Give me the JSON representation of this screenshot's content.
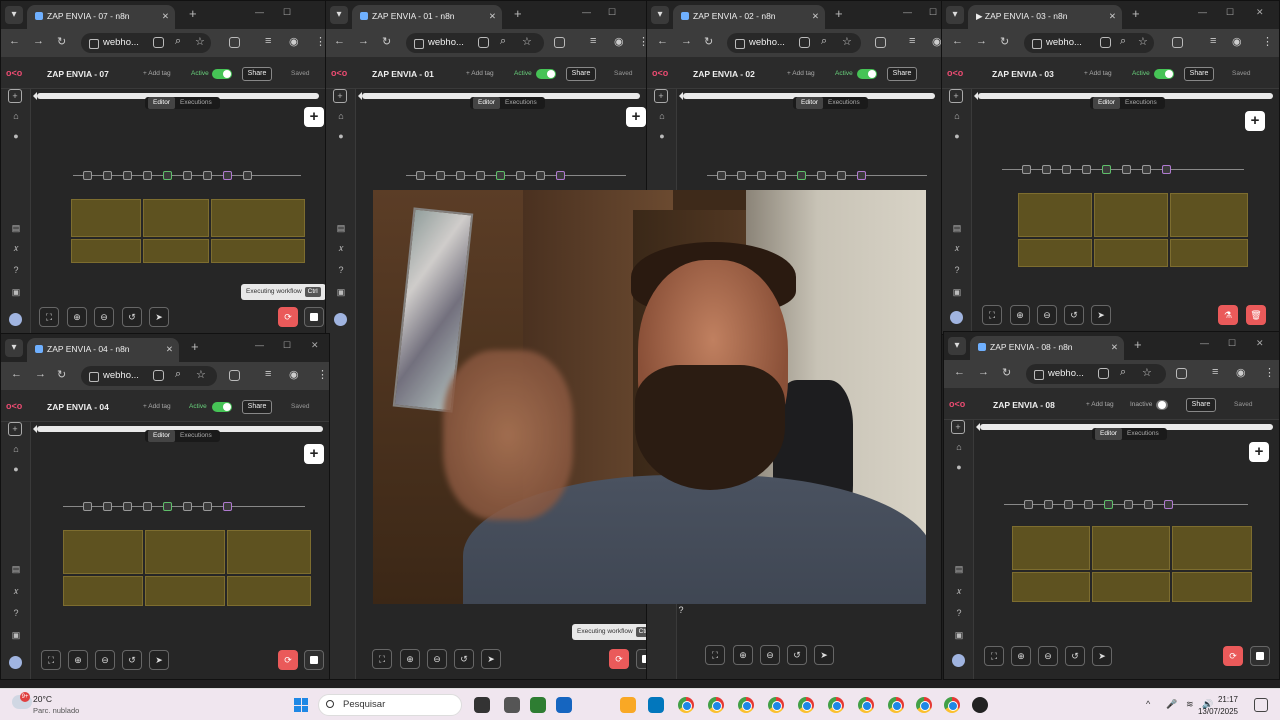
{
  "windows": [
    {
      "tab": "ZAP ENVIA - 07 - n8n",
      "url": "webho...",
      "workflow": "ZAP ENVIA - 07",
      "status": "Active"
    },
    {
      "tab": "ZAP ENVIA - 01 - n8n",
      "url": "webho...",
      "workflow": "ZAP ENVIA - 01",
      "status": "Active"
    },
    {
      "tab": "ZAP ENVIA - 02 - n8n",
      "url": "webho...",
      "workflow": "ZAP ENVIA - 02",
      "status": "Active"
    },
    {
      "tab": "ZAP ENVIA - 03 - n8n",
      "url": "webho...",
      "workflow": "ZAP ENVIA - 03",
      "status": "Active"
    },
    {
      "tab": "ZAP ENVIA - 04 - n8n",
      "url": "webho...",
      "workflow": "ZAP ENVIA - 04",
      "status": "Active"
    },
    {
      "tab": "ZAP ENVIA - 08 - n8n",
      "url": "webho...",
      "workflow": "ZAP ENVIA - 08",
      "status": "Inactive"
    }
  ],
  "common": {
    "add_tag": "+ Add tag",
    "share": "Share",
    "saved": "Saved",
    "editor_tab": "Editor",
    "executions_tab": "Executions",
    "executing_tooltip": "Executing workflow",
    "tooltip_kbd": "Ctrl"
  },
  "taskbar": {
    "temperature": "20°C",
    "condition": "Parc. nublado",
    "weather_badge": "9+",
    "search_placeholder": "Pesquisar",
    "time": "21:17",
    "date": "13/07/2025"
  },
  "colors": {
    "accent": "#ea4b71",
    "active_toggle": "#46c356",
    "execute_button": "#ea5a5a",
    "workflow_group": "#5e5220"
  }
}
